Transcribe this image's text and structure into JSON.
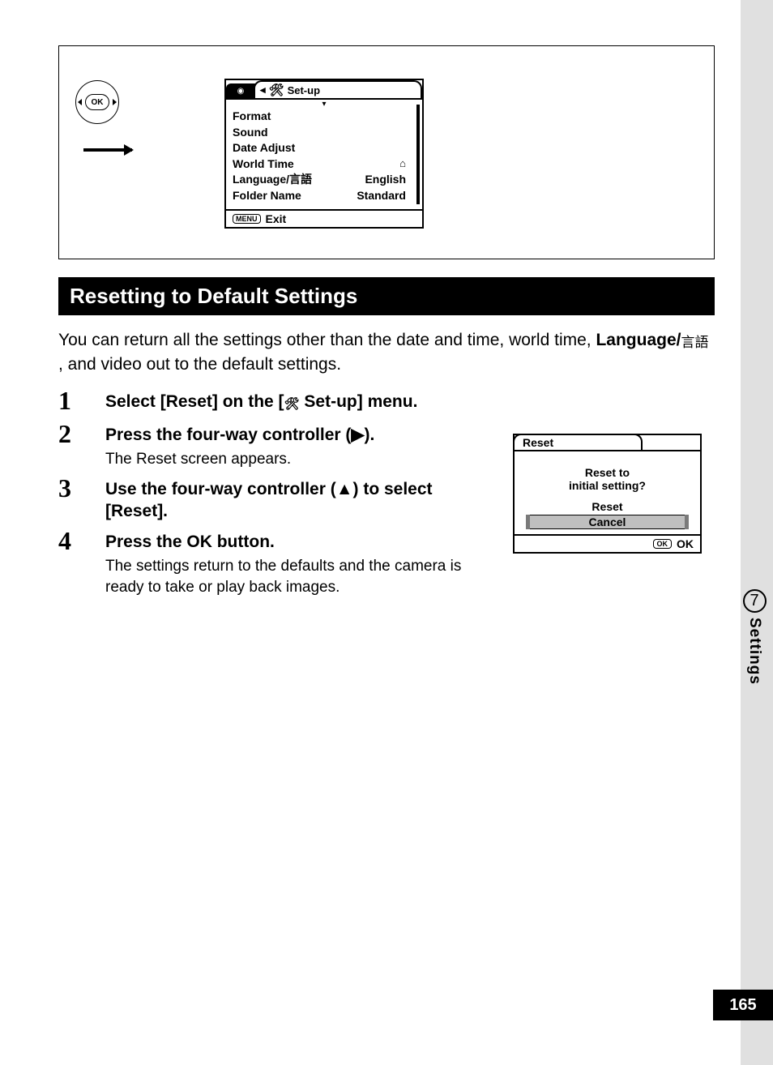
{
  "page_number": "165",
  "side_tab": {
    "number": "7",
    "label": "Settings"
  },
  "setup_menu": {
    "title": "Set-up",
    "items": [
      {
        "label": "Format",
        "value": ""
      },
      {
        "label": "Sound",
        "value": ""
      },
      {
        "label": "Date Adjust",
        "value": ""
      },
      {
        "label": "World Time",
        "value": "⌂"
      },
      {
        "label": "Language/言語",
        "value": "English"
      },
      {
        "label": "Folder Name",
        "value": "Standard"
      }
    ],
    "footer": {
      "button": "MENU",
      "label": "Exit"
    }
  },
  "ok_label": "OK",
  "heading": "Resetting to Default Settings",
  "intro_part1": "You can return all the settings other than the date and time, world time, ",
  "intro_language_bold": "Language/",
  "intro_gengo": "言語",
  "intro_part2": " , and video out to the default settings.",
  "steps": [
    {
      "n": "1",
      "title_prefix": "Select [Reset] on the [",
      "title_suffix": " Set-up] menu."
    },
    {
      "n": "2",
      "title": "Press the four-way controller (▶).",
      "sub": "The Reset screen appears."
    },
    {
      "n": "3",
      "title": "Use the four-way controller (▲) to select [Reset]."
    },
    {
      "n": "4",
      "title": "Press the OK button.",
      "sub": "The settings return to the defaults and the camera is ready to take or play back images."
    }
  ],
  "reset_screen": {
    "tab": "Reset",
    "line1": "Reset to",
    "line2": "initial setting?",
    "option1": "Reset",
    "option2": "Cancel",
    "footer_btn": "OK",
    "footer_label": "OK"
  }
}
